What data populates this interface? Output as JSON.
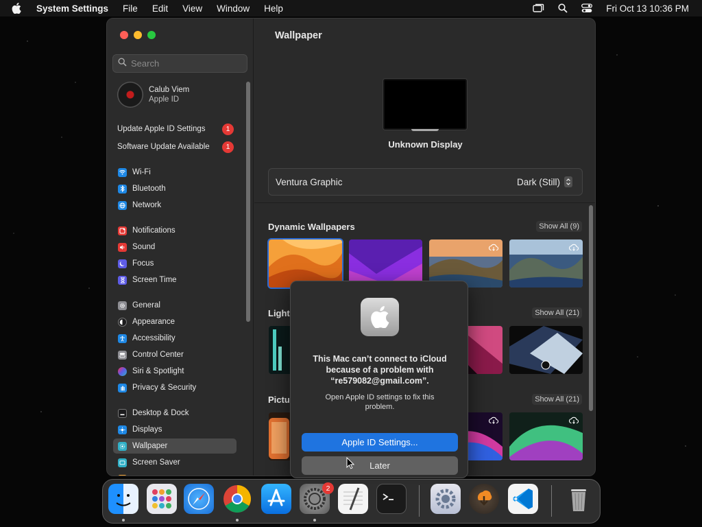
{
  "menubar": {
    "app_name": "System Settings",
    "menus": [
      "File",
      "Edit",
      "View",
      "Window",
      "Help"
    ],
    "clock": "Fri Oct 13  10:36 PM"
  },
  "sidebar": {
    "search_placeholder": "Search",
    "profile": {
      "name": "Calub Viem",
      "subtitle": "Apple ID"
    },
    "alerts": [
      {
        "label": "Update Apple ID Settings",
        "badge": "1"
      },
      {
        "label": "Software Update Available",
        "badge": "1"
      }
    ],
    "items": [
      {
        "label": "Wi-Fi",
        "color": "#1e88e5"
      },
      {
        "label": "Bluetooth",
        "color": "#1e88e5"
      },
      {
        "label": "Network",
        "color": "#1e88e5"
      },
      {
        "label": "Notifications",
        "color": "#e53935"
      },
      {
        "label": "Sound",
        "color": "#e53935"
      },
      {
        "label": "Focus",
        "color": "#5e5ce6"
      },
      {
        "label": "Screen Time",
        "color": "#5e5ce6"
      },
      {
        "label": "General",
        "color": "#8e8e93"
      },
      {
        "label": "Appearance",
        "color": "#1c1c1e"
      },
      {
        "label": "Accessibility",
        "color": "#1e88e5"
      },
      {
        "label": "Control Center",
        "color": "#8e8e93"
      },
      {
        "label": "Siri & Spotlight",
        "color": "#bf5af2"
      },
      {
        "label": "Privacy & Security",
        "color": "#1e88e5"
      },
      {
        "label": "Desktop & Dock",
        "color": "#1c1c1e"
      },
      {
        "label": "Displays",
        "color": "#1e88e5"
      },
      {
        "label": "Wallpaper",
        "color": "#30b0c7"
      },
      {
        "label": "Screen Saver",
        "color": "#30b0c7"
      }
    ],
    "active_item": "Wallpaper"
  },
  "content": {
    "title": "Wallpaper",
    "display_name": "Unknown Display",
    "picker": {
      "label": "Ventura Graphic",
      "value": "Dark (Still)"
    },
    "sections": [
      {
        "title": "Dynamic Wallpapers",
        "show_all": "Show All (9)"
      },
      {
        "title": "Light",
        "show_all": "Show All (21)"
      },
      {
        "title": "Pictu",
        "show_all": "Show All (21)"
      }
    ]
  },
  "dialog": {
    "title": "This Mac can’t connect to iCloud because of a problem with “re579082@gmail.com”.",
    "body": "Open Apple ID settings to fix this problem.",
    "primary_button": "Apple ID Settings...",
    "secondary_button": "Later"
  },
  "dock": {
    "settings_badge": "2"
  }
}
